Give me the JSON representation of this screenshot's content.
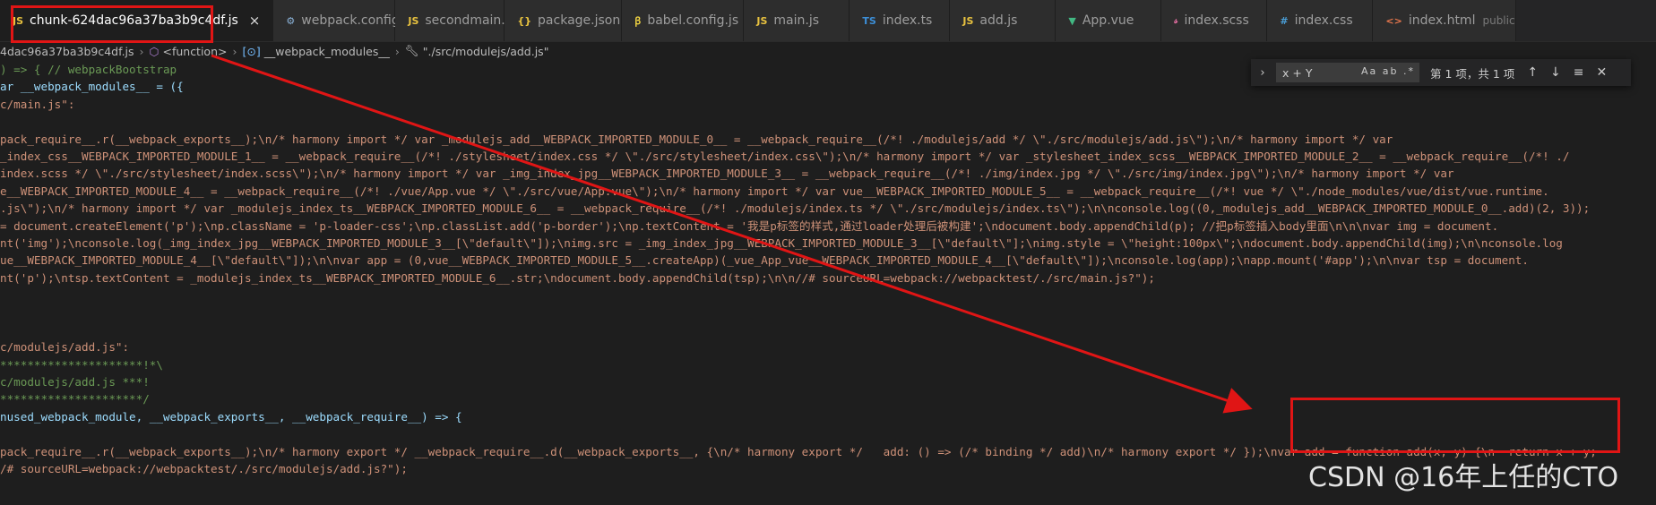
{
  "tabs": [
    {
      "icon": "JS",
      "label": "chunk-624dac96a37ba3b9c4df.js",
      "close": "×"
    },
    {
      "icon": "⚙",
      "label": "webpack.config.js"
    },
    {
      "icon": "JS",
      "label": "secondmain.js"
    },
    {
      "icon": "{}",
      "label": "package.json"
    },
    {
      "icon": "ꞵ",
      "label": "babel.config.js"
    },
    {
      "icon": "JS",
      "label": "main.js"
    },
    {
      "icon": "TS",
      "label": "index.ts"
    },
    {
      "icon": "JS",
      "label": "add.js"
    },
    {
      "icon": "▼",
      "label": "App.vue"
    },
    {
      "icon": "𝓈",
      "label": "index.scss"
    },
    {
      "icon": "#",
      "label": "index.css"
    },
    {
      "icon": "<>",
      "label": "index.html",
      "extra": "public"
    }
  ],
  "breadcrumb": {
    "file": "4dac96a37ba3b9c4df.js",
    "function": "<function>",
    "modules": "__webpack_modules__",
    "entry": "\"./src/modulejs/add.js\""
  },
  "find_widget": {
    "query": "x + Y",
    "options": "Aa ab .*",
    "count": "第 1 项，共 1 项",
    "prev": "↑",
    "next": "↓",
    "menu": "≡",
    "close": "✕",
    "toggle": "›"
  },
  "code_lines": [
    ") => { // webpackBootstrap",
    "ar __webpack_modules__ = ({",
    "c/main.js\":",
    "",
    "pack_require__.r(__webpack_exports__);\\n/* harmony import */ var _modulejs_add__WEBPACK_IMPORTED_MODULE_0__ = __webpack_require__(/*! ./modulejs/add */ \\\"./src/modulejs/add.js\\\");\\n/* harmony import */ var",
    "_index_css__WEBPACK_IMPORTED_MODULE_1__ = __webpack_require__(/*! ./stylesheet/index.css */ \\\"./src/stylesheet/index.css\\\");\\n/* harmony import */ var _stylesheet_index_scss__WEBPACK_IMPORTED_MODULE_2__ = __webpack_require__(/*! ./",
    "index.scss */ \\\"./src/stylesheet/index.scss\\\");\\n/* harmony import */ var _img_index_jpg__WEBPACK_IMPORTED_MODULE_3__ = __webpack_require__(/*! ./img/index.jpg */ \\\"./src/img/index.jpg\\\");\\n/* harmony import */ var",
    "e__WEBPACK_IMPORTED_MODULE_4__ = __webpack_require__(/*! ./vue/App.vue */ \\\"./src/vue/App.vue\\\");\\n/* harmony import */ var vue__WEBPACK_IMPORTED_MODULE_5__ = __webpack_require__(/*! vue */ \\\"./node_modules/vue/dist/vue.runtime.",
    ".js\\\");\\n/* harmony import */ var _modulejs_index_ts__WEBPACK_IMPORTED_MODULE_6__ = __webpack_require__(/*! ./modulejs/index.ts */ \\\"./src/modulejs/index.ts\\\");\\n\\nconsole.log((0,_modulejs_add__WEBPACK_IMPORTED_MODULE_0__.add)(2, 3));",
    "= document.createElement('p');\\np.className = 'p-loader-css';\\np.classList.add('p-border');\\np.textContent = '我是p标签的样式,通过loader处理后被构建';\\ndocument.body.appendChild(p); //把p标签插入body里面\\n\\n\\nvar img = document.",
    "nt('img');\\nconsole.log(_img_index_jpg__WEBPACK_IMPORTED_MODULE_3__[\\\"default\\\"]);\\nimg.src = _img_index_jpg__WEBPACK_IMPORTED_MODULE_3__[\\\"default\\\"];\\nimg.style = \\\"height:100px\\\";\\ndocument.body.appendChild(img);\\n\\nconsole.log",
    "ue__WEBPACK_IMPORTED_MODULE_4__[\\\"default\\\"]);\\n\\nvar app = (0,vue__WEBPACK_IMPORTED_MODULE_5__.createApp)(_vue_App_vue__WEBPACK_IMPORTED_MODULE_4__[\\\"default\\\"]);\\nconsole.log(app);\\napp.mount('#app');\\n\\nvar tsp = document.",
    "nt('p');\\ntsp.textContent = _modulejs_index_ts__WEBPACK_IMPORTED_MODULE_6__.str;\\ndocument.body.appendChild(tsp);\\n\\n//# sourceURL=webpack://webpacktest/./src/main.js?\");",
    "",
    "",
    "",
    "c/modulejs/add.js\":",
    "*********************!*\\",
    "c/modulejs/add.js ***!",
    "*********************/",
    "nused_webpack_module, __webpack_exports__, __webpack_require__) => {",
    "",
    "pack_require__.r(__webpack_exports__);\\n/* harmony export */ __webpack_require__.d(__webpack_exports__, {\\n/* harmony export */   add: () => (/* binding */ add)\\n/* harmony export */ });\\nvar add = function add(x, y) {\\n  return x + y;",
    "/# sourceURL=webpack://webpacktest/./src/modulejs/add.js?\");"
  ],
  "watermark": "CSDN @16年上任的CTO"
}
